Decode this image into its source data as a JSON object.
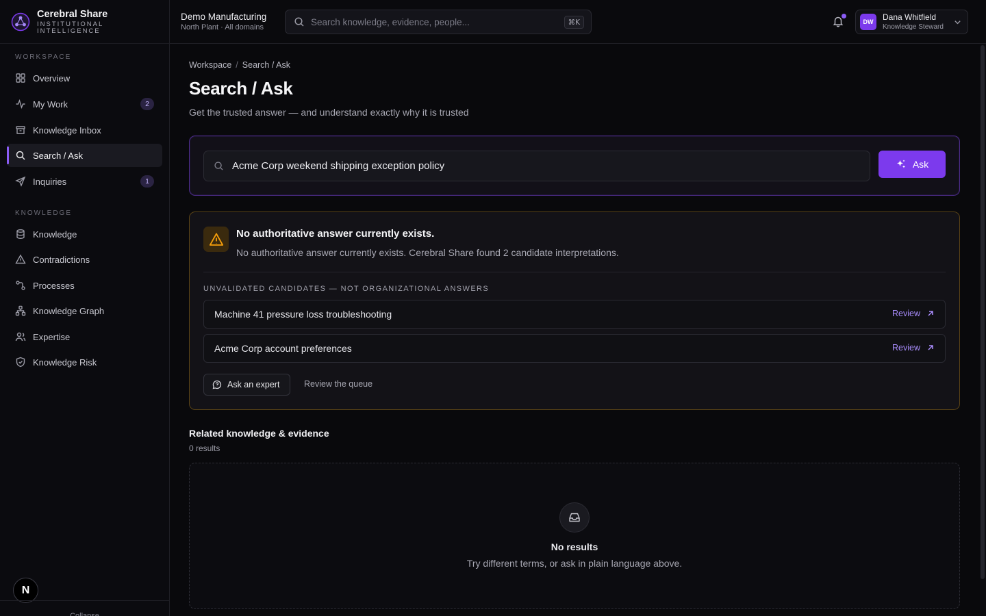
{
  "brand": {
    "name": "Cerebral Share",
    "tagline_line1": "Institutional",
    "tagline_line2": "Intelligence",
    "accent": "#7c3aed"
  },
  "sidebar": {
    "sections": [
      {
        "label": "Workspace"
      },
      {
        "label": "Knowledge"
      }
    ],
    "items": [
      {
        "label": "Overview",
        "icon": "grid-icon"
      },
      {
        "label": "My Work",
        "icon": "activity-icon",
        "badge": "2"
      },
      {
        "label": "Knowledge Inbox",
        "icon": "archive-icon"
      },
      {
        "label": "Search / Ask",
        "icon": "search-icon",
        "active": true
      },
      {
        "label": "Inquiries",
        "icon": "send-icon",
        "badge": "1"
      },
      {
        "label": "Knowledge",
        "icon": "database-icon"
      },
      {
        "label": "Contradictions",
        "icon": "warning-icon"
      },
      {
        "label": "Processes",
        "icon": "workflow-icon"
      },
      {
        "label": "Knowledge Graph",
        "icon": "network-icon"
      },
      {
        "label": "Expertise",
        "icon": "users-icon"
      },
      {
        "label": "Knowledge Risk",
        "icon": "shield-icon"
      }
    ],
    "n_badge": "N",
    "collapse_label": "Collapse"
  },
  "topbar": {
    "org_name": "Demo Manufacturing",
    "org_sub": "North Plant · All domains",
    "search_placeholder": "Search knowledge, evidence, people...",
    "shortcut": "⌘K",
    "user": {
      "initials": "DW",
      "name": "Dana Whitfield",
      "role": "Knowledge Steward"
    }
  },
  "main": {
    "breadcrumb": [
      "Workspace",
      "Search / Ask"
    ],
    "title": "Search / Ask",
    "subtitle": "Get the trusted answer — and understand exactly why it is trusted",
    "query": "Acme Corp weekend shipping exception policy",
    "ask_label": "Ask",
    "alert": {
      "title": "No authoritative answer currently exists.",
      "description": "No authoritative answer currently exists. Cerebral Share found 2 candidate interpretations.",
      "candidates_label": "Unvalidated candidates — not organizational answers",
      "candidates": [
        {
          "title": "Machine 41 pressure loss troubleshooting",
          "action": "Review"
        },
        {
          "title": "Acme Corp account preferences",
          "action": "Review"
        }
      ],
      "expert_label": "Ask an expert",
      "queue_label": "Review the queue",
      "warning_color": "#f59e0b"
    },
    "related": {
      "title": "Related knowledge & evidence",
      "count": "0 results",
      "empty_title": "No results",
      "empty_desc": "Try different terms, or ask in plain language above."
    }
  }
}
